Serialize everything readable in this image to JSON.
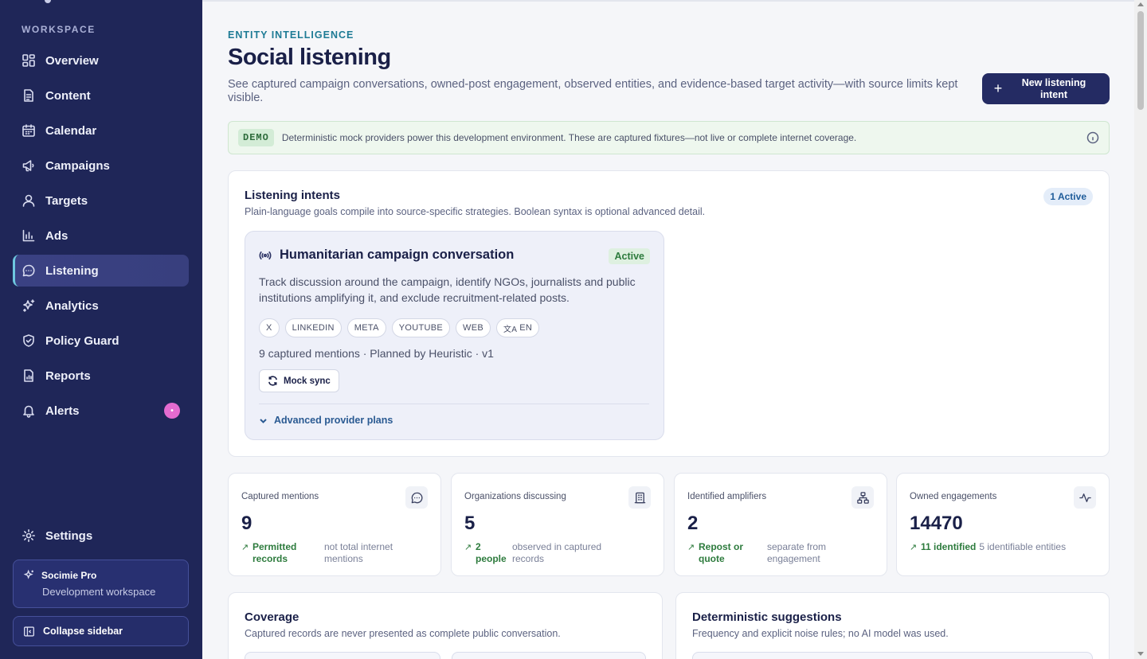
{
  "sidebar": {
    "section_label": "WORKSPACE",
    "items": [
      {
        "label": "Overview",
        "icon": "grid-icon"
      },
      {
        "label": "Content",
        "icon": "document-icon"
      },
      {
        "label": "Calendar",
        "icon": "calendar-icon"
      },
      {
        "label": "Campaigns",
        "icon": "megaphone-icon"
      },
      {
        "label": "Targets",
        "icon": "user-icon"
      },
      {
        "label": "Ads",
        "icon": "bar-chart-icon"
      },
      {
        "label": "Listening",
        "icon": "chat-bubble-icon",
        "active": true
      },
      {
        "label": "Analytics",
        "icon": "sparkles-icon"
      },
      {
        "label": "Policy Guard",
        "icon": "shield-check-icon"
      },
      {
        "label": "Reports",
        "icon": "report-icon"
      },
      {
        "label": "Alerts",
        "icon": "bell-icon",
        "badge": "•"
      }
    ],
    "settings_label": "Settings",
    "plan": {
      "name": "Socimie Pro",
      "workspace": "Development workspace"
    },
    "collapse_label": "Collapse sidebar"
  },
  "header": {
    "eyebrow": "ENTITY INTELLIGENCE",
    "title": "Social listening",
    "description": "See captured campaign conversations, owned-post engagement, observed entities, and evidence-based target activity—with source limits kept visible.",
    "new_intent_label": "New listening intent"
  },
  "demo_banner": {
    "badge": "DEMO",
    "text": "Deterministic mock providers power this development environment. These are captured fixtures—not live or complete internet coverage."
  },
  "intents": {
    "title": "Listening intents",
    "subtitle": "Plain-language goals compile into source-specific strategies. Boolean syntax is optional advanced detail.",
    "active_count": "1 Active",
    "card": {
      "name": "Humanitarian campaign conversation",
      "status": "Active",
      "description": "Track discussion around the campaign, identify NGOs, journalists and public institutions amplifying it, and exclude recruitment-related posts.",
      "sources": [
        "X",
        "LINKEDIN",
        "META",
        "YOUTUBE",
        "WEB"
      ],
      "language": "EN",
      "meta": "9 captured mentions · Planned by Heuristic · v1",
      "sync_label": "Mock sync",
      "advanced_label": "Advanced provider plans"
    }
  },
  "stats": [
    {
      "label": "Captured mentions",
      "value": "9",
      "highlight": "Permitted records",
      "note": "not total internet mentions",
      "icon": "message-icon"
    },
    {
      "label": "Organizations discussing",
      "value": "5",
      "highlight": "2 people",
      "note": "observed in captured records",
      "icon": "building-icon"
    },
    {
      "label": "Identified amplifiers",
      "value": "2",
      "highlight": "Repost or quote",
      "note": "separate from engagement",
      "icon": "network-icon"
    },
    {
      "label": "Owned engagements",
      "value": "14470",
      "highlight": "11 identified",
      "note": "5 identifiable entities",
      "icon": "activity-icon"
    }
  ],
  "coverage": {
    "title": "Coverage",
    "subtitle": "Captured records are never presented as complete public conversation."
  },
  "suggestions": {
    "title": "Deterministic suggestions",
    "subtitle": "Frequency and explicit noise rules; no AI model was used."
  },
  "colors": {
    "sidebar_bg": "#1f2658",
    "accent": "#242b63",
    "eyebrow": "#1e7b95",
    "positive": "#2d7b3d",
    "alert_badge": "#e36bd0"
  }
}
